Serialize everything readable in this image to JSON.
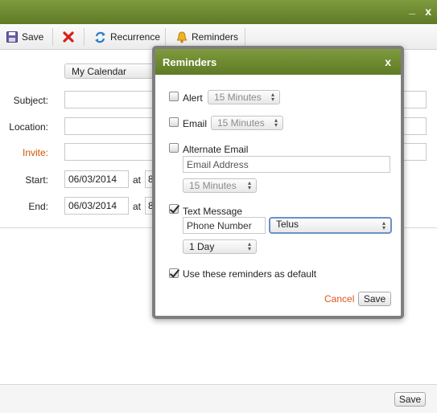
{
  "titlebar": {
    "minimize_label": "_",
    "close_label": "x"
  },
  "toolbar": {
    "save_label": "Save",
    "recurrence_label": "Recurrence",
    "reminders_label": "Reminders"
  },
  "form": {
    "calendar_value": "My Calendar",
    "subject_label": "Subject:",
    "location_label": "Location:",
    "invite_label": "Invite:",
    "start_label": "Start:",
    "end_label": "End:",
    "start_date": "06/03/2014",
    "end_date": "06/03/2014",
    "at_label": "at",
    "start_time_partial": "8:",
    "end_time_partial": "8:"
  },
  "footer": {
    "save_label": "Save"
  },
  "dialog": {
    "title": "Reminders",
    "close_label": "x",
    "alert_label": "Alert",
    "alert_time": "15 Minutes",
    "email_label": "Email",
    "email_time": "15 Minutes",
    "alt_email_label": "Alternate Email",
    "alt_email_placeholder": "Email Address",
    "alt_email_time": "15 Minutes",
    "text_message_label": "Text Message",
    "phone_placeholder": "Phone Number",
    "carrier_value": "Telus",
    "text_time": "1 Day",
    "default_label": "Use these reminders as default",
    "cancel_label": "Cancel",
    "save_label": "Save",
    "checks": {
      "alert": false,
      "email": false,
      "alt_email": false,
      "text_message": true,
      "default": true
    }
  },
  "colors": {
    "header_green": "#6b8a30",
    "invite_orange": "#d35400",
    "cancel_orange": "#e2541c"
  }
}
